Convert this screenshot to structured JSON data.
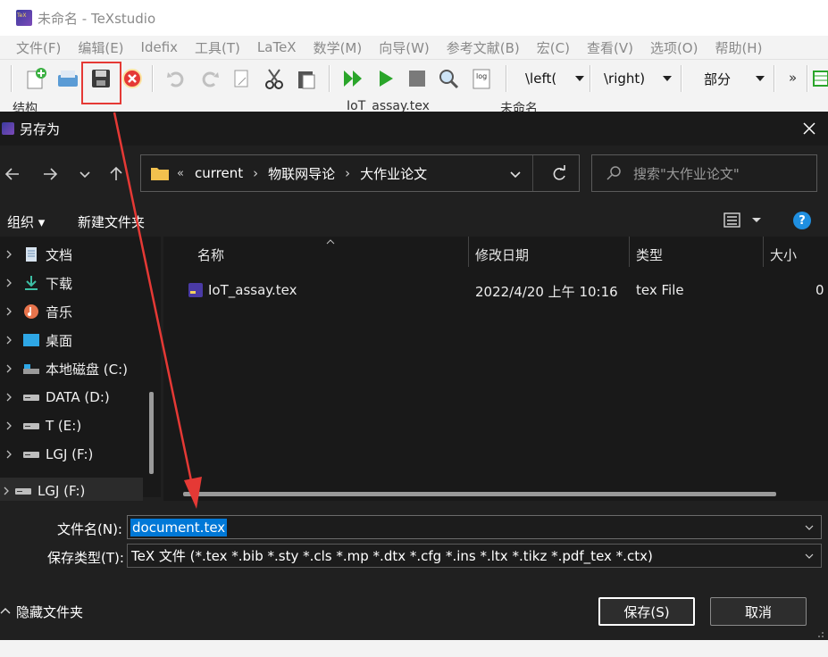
{
  "app": {
    "title": "未命名 - TeXstudio",
    "menu": [
      "文件(F)",
      "编辑(E)",
      "Idefix",
      "工具(T)",
      "LaTeX",
      "数学(M)",
      "向导(W)",
      "参考文献(B)",
      "宏(C)",
      "查看(V)",
      "选项(O)",
      "帮助(H)"
    ],
    "toolbar": {
      "left_combo": "\\left(",
      "right_combo": "\\right)",
      "section_combo": "部分",
      "overflow": "»",
      "log_label": "log"
    },
    "tabs": [
      "结构",
      "IoT_assay.tex",
      "未命名"
    ]
  },
  "dialog": {
    "title": "另存为",
    "breadcrumb": [
      "current",
      "物联网导论",
      "大作业论文"
    ],
    "breadcrumb_prefix": "«",
    "search_placeholder": "搜索\"大作业论文\"",
    "organize_label": "组织 ▾",
    "new_folder_label": "新建文件夹",
    "nav_items": [
      {
        "label": "文档",
        "icon": "documents-icon"
      },
      {
        "label": "下载",
        "icon": "download-icon"
      },
      {
        "label": "音乐",
        "icon": "music-icon"
      },
      {
        "label": "桌面",
        "icon": "desktop-icon"
      },
      {
        "label": "本地磁盘 (C:)",
        "icon": "drive-icon"
      },
      {
        "label": "DATA (D:)",
        "icon": "drive-icon"
      },
      {
        "label": "T (E:)",
        "icon": "drive-icon"
      },
      {
        "label": "LGJ (F:)",
        "icon": "drive-icon"
      }
    ],
    "nav_bottom_item": "LGJ (F:)",
    "columns": [
      "名称",
      "修改日期",
      "类型",
      "大小"
    ],
    "files": [
      {
        "name": "IoT_assay.tex",
        "modified": "2022/4/20 上午 10:16",
        "type": "tex File",
        "size": "0"
      }
    ],
    "filename_label": "文件名(N):",
    "filename_value": "document.tex",
    "filetype_label": "保存类型(T):",
    "filetype_value": "TeX 文件 (*.tex *.bib *.sty *.cls *.mp *.dtx *.cfg *.ins *.ltx *.tikz *.pdf_tex *.ctx)",
    "hide_folders_label": "隐藏文件夹",
    "save_label": "保存(S)",
    "cancel_label": "取消"
  },
  "colors": {
    "dialog_bg": "#202020",
    "pane_bg": "#191919",
    "selection": "#0078d7",
    "annotation": "#e53935"
  }
}
